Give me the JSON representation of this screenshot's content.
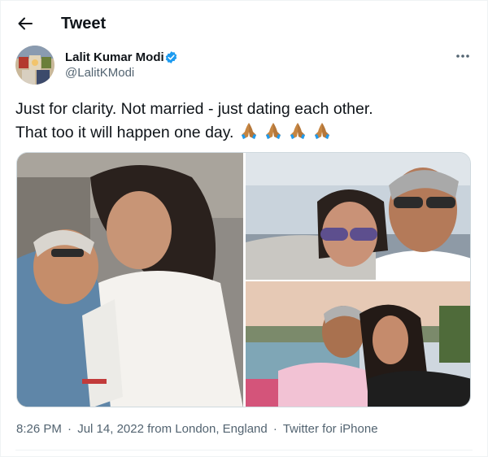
{
  "header": {
    "title": "Tweet"
  },
  "author": {
    "name": "Lalit Kumar Modi",
    "handle": "@LalitKModi"
  },
  "tweet": {
    "line1": "Just for clarity. Not married - just dating each other.",
    "line2": "That too it will happen one day.",
    "emoji": [
      "folded-hands",
      "folded-hands",
      "folded-hands",
      "folded-hands"
    ]
  },
  "meta": {
    "time": "8:26 PM",
    "date": "Jul 14, 2022",
    "location": "from London, England",
    "separator": "·",
    "client": "Twitter for iPhone"
  },
  "colors": {
    "text": "#0f1419",
    "secondary": "#536471",
    "verified": "#1d9bf0",
    "border": "#cfd9de"
  },
  "icons": [
    "back-arrow-icon",
    "verified-badge-icon",
    "more-options-icon",
    "folded-hands-emoji"
  ]
}
